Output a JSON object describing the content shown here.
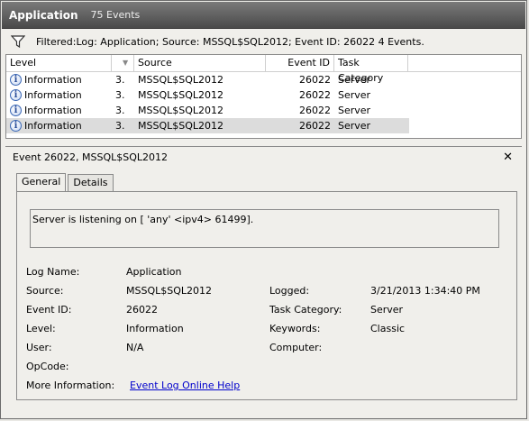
{
  "header": {
    "title": "Application",
    "count": "75 Events"
  },
  "filter": {
    "text": "Filtered:Log: Application; Source: MSSQL$SQL2012; Event ID: 26022 4 Events."
  },
  "grid": {
    "columns": [
      "Level",
      "",
      "Source",
      "Event ID",
      "Task Category"
    ],
    "rows": [
      {
        "level": "Information",
        "sort": "3.",
        "source": "MSSQL$SQL2012",
        "event_id": "26022",
        "category": "Server"
      },
      {
        "level": "Information",
        "sort": "3.",
        "source": "MSSQL$SQL2012",
        "event_id": "26022",
        "category": "Server"
      },
      {
        "level": "Information",
        "sort": "3.",
        "source": "MSSQL$SQL2012",
        "event_id": "26022",
        "category": "Server"
      },
      {
        "level": "Information",
        "sort": "3.",
        "source": "MSSQL$SQL2012",
        "event_id": "26022",
        "category": "Server"
      }
    ]
  },
  "detail": {
    "title": "Event 26022, MSSQL$SQL2012",
    "close_glyph": "✕",
    "tabs": [
      "General",
      "Details"
    ],
    "message": "Server is listening on [ 'any' <ipv4> 61499].",
    "labels": {
      "log_name": "Log Name:",
      "source": "Source:",
      "event_id": "Event ID:",
      "level": "Level:",
      "user": "User:",
      "opcode": "OpCode:",
      "more_info": "More Information:",
      "logged": "Logged:",
      "task_category": "Task Category:",
      "keywords": "Keywords:",
      "computer": "Computer:"
    },
    "values": {
      "log_name": "Application",
      "source": "MSSQL$SQL2012",
      "event_id": "26022",
      "level": "Information",
      "user": "N/A",
      "opcode": "",
      "more_info_link": "Event Log Online Help",
      "logged": "3/21/2013 1:34:40 PM",
      "task_category": "Server",
      "keywords": "Classic",
      "computer": ""
    }
  }
}
